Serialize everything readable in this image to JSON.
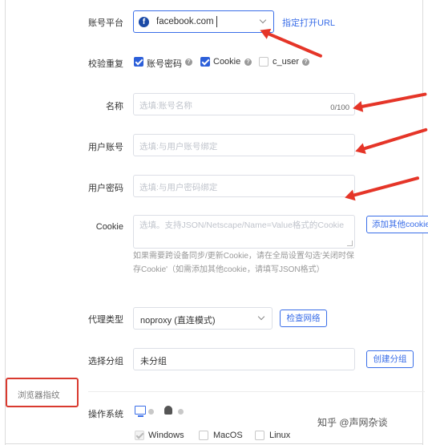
{
  "account_platform": {
    "label": "账号平台",
    "value": "facebook.com",
    "link": "指定打开URL"
  },
  "verify_repeat": {
    "label": "校验重复",
    "options": [
      {
        "label": "账号密码",
        "checked": true
      },
      {
        "label": "Cookie",
        "checked": true
      },
      {
        "label": "c_user",
        "checked": false
      }
    ]
  },
  "name_field": {
    "label": "名称",
    "placeholder": "选填:账号名称",
    "counter": "0/100"
  },
  "user_account": {
    "label": "用户账号",
    "placeholder": "选填:与用户账号绑定"
  },
  "user_password": {
    "label": "用户密码",
    "placeholder": "选填:与用户密码绑定"
  },
  "cookie": {
    "label": "Cookie",
    "placeholder": "选填。支持JSON/Netscape/Name=Value格式的Cookie",
    "button": "添加其他cookie",
    "hint": "如果需要跨设备同步/更新Cookie，请在全局设置勾选'关闭时保存Cookie'（如需添加其他cookie，请填写JSON格式）"
  },
  "proxy": {
    "label": "代理类型",
    "value": "noproxy (直连模式)",
    "button": "检查网络"
  },
  "group": {
    "label": "选择分组",
    "value": "未分组",
    "button": "创建分组"
  },
  "fingerprint_section": {
    "label": "浏览器指纹"
  },
  "os": {
    "label": "操作系统",
    "options": [
      "Windows",
      "MacOS",
      "Linux"
    ]
  },
  "watermark": "知乎 @声网杂谈",
  "colors": {
    "accent": "#3a6ee8",
    "arrow_red": "#e53528",
    "highlight_box": "#d93a2f"
  }
}
